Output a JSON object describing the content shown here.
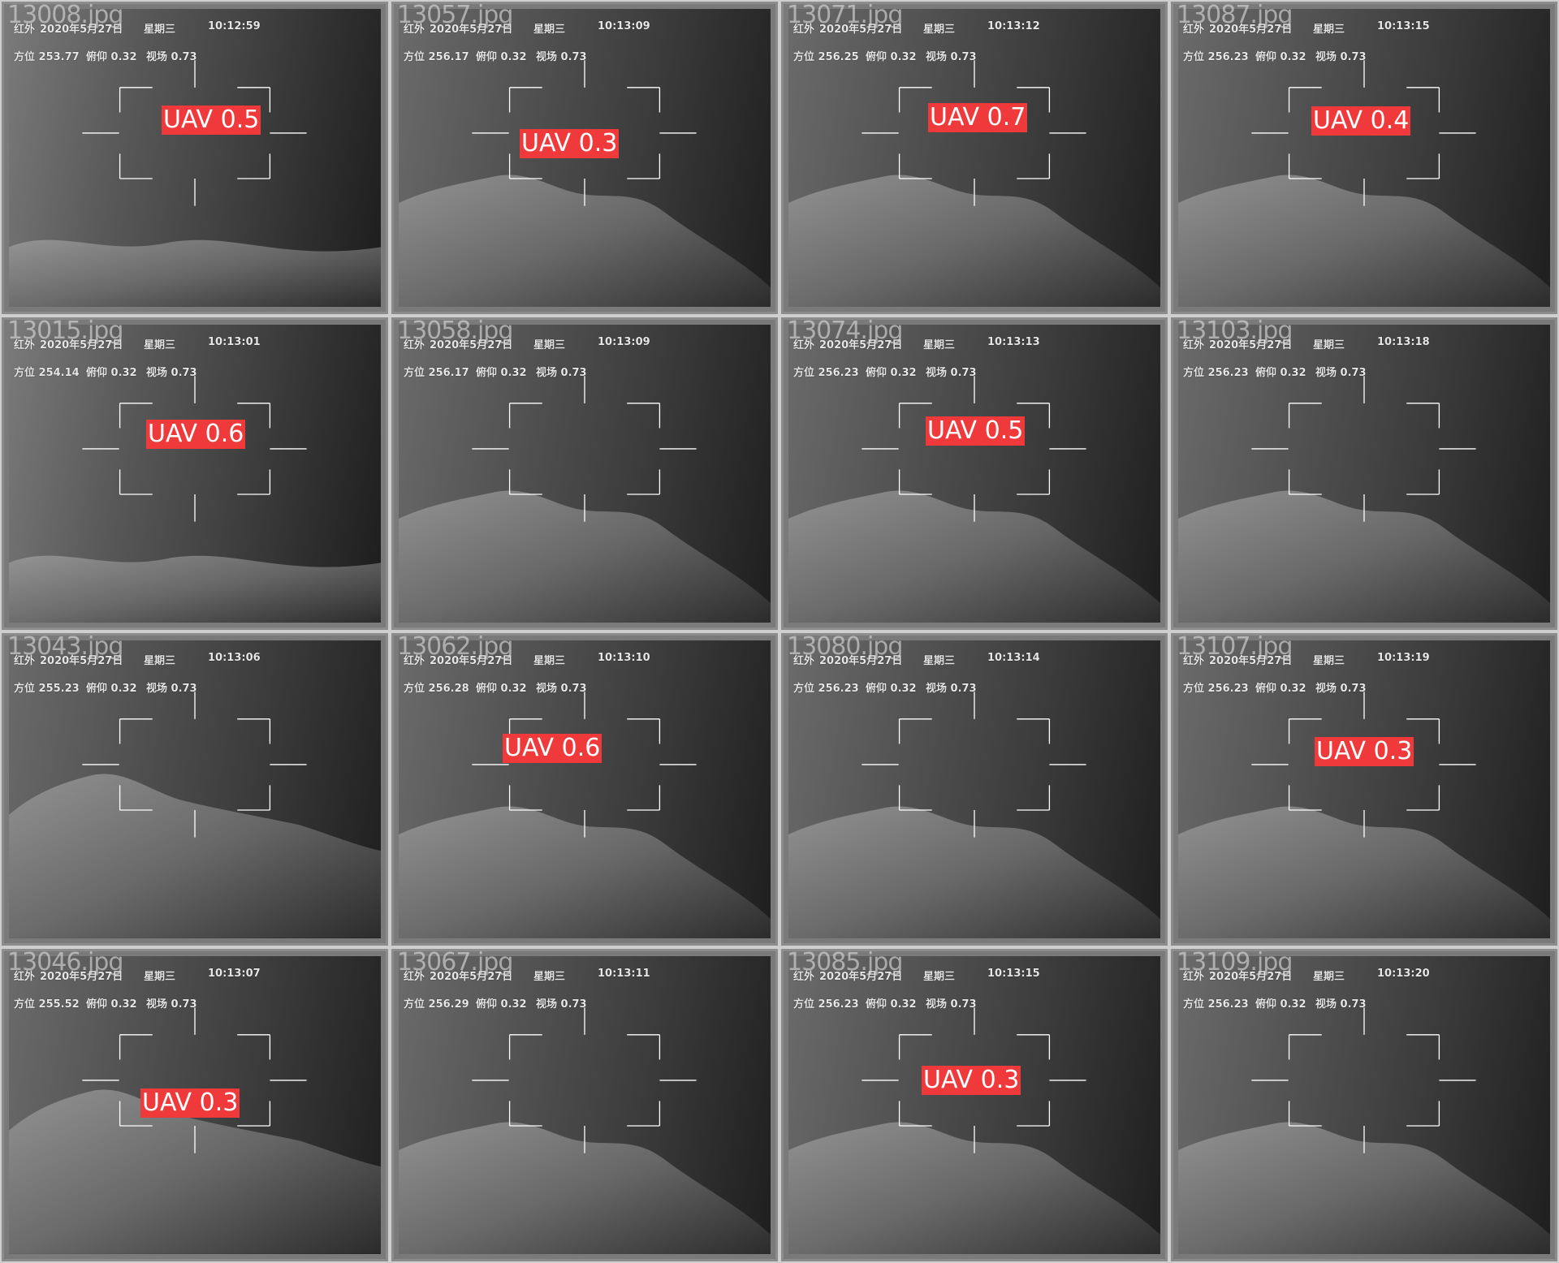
{
  "tiles": [
    {
      "filename": "13008.jpg",
      "label": "红外",
      "date": "2020年5月27日",
      "weekday": "星期三",
      "time": "10:12:59",
      "azimuth": "方位 253.77",
      "pitch": "俯仰 0.32",
      "fov": "视场 0.73",
      "detection": "UAV 0.5",
      "scene": "fog"
    },
    {
      "filename": "13057.jpg",
      "label": "红外",
      "date": "2020年5月27日",
      "weekday": "星期三",
      "time": "10:13:09",
      "azimuth": "方位 256.17",
      "pitch": "俯仰 0.32",
      "fov": "视场 0.73",
      "detection": "UAV 0.3",
      "scene": "mountain"
    },
    {
      "filename": "13071.jpg",
      "label": "红外",
      "date": "2020年5月27日",
      "weekday": "星期三",
      "time": "10:13:12",
      "azimuth": "方位 256.25",
      "pitch": "俯仰 0.32",
      "fov": "视场 0.73",
      "detection": "UAV 0.7",
      "scene": "mountain"
    },
    {
      "filename": "13087.jpg",
      "label": "红外",
      "date": "2020年5月27日",
      "weekday": "星期三",
      "time": "10:13:15",
      "azimuth": "方位 256.23",
      "pitch": "俯仰 0.32",
      "fov": "视场 0.73",
      "detection": "UAV 0.4",
      "scene": "mountain"
    },
    {
      "filename": "13015.jpg",
      "label": "红外",
      "date": "2020年5月27日",
      "weekday": "星期三",
      "time": "10:13:01",
      "azimuth": "方位 254.14",
      "pitch": "俯仰 0.32",
      "fov": "视场 0.73",
      "detection": "UAV 0.6",
      "scene": "fog"
    },
    {
      "filename": "13058.jpg",
      "label": "红外",
      "date": "2020年5月27日",
      "weekday": "星期三",
      "time": "10:13:09",
      "azimuth": "方位 256.17",
      "pitch": "俯仰 0.32",
      "fov": "视场 0.73",
      "detection": "",
      "scene": "mountain"
    },
    {
      "filename": "13074.jpg",
      "label": "红外",
      "date": "2020年5月27日",
      "weekday": "星期三",
      "time": "10:13:13",
      "azimuth": "方位 256.23",
      "pitch": "俯仰 0.32",
      "fov": "视场 0.73",
      "detection": "UAV 0.5",
      "scene": "mountain"
    },
    {
      "filename": "13103.jpg",
      "label": "红外",
      "date": "2020年5月27日",
      "weekday": "星期三",
      "time": "10:13:18",
      "azimuth": "方位 256.23",
      "pitch": "俯仰 0.32",
      "fov": "视场 0.73",
      "detection": "",
      "scene": "mountain"
    },
    {
      "filename": "13043.jpg",
      "label": "红外",
      "date": "2020年5月27日",
      "weekday": "星期三",
      "time": "10:13:06",
      "azimuth": "方位 255.23",
      "pitch": "俯仰 0.32",
      "fov": "视场 0.73",
      "detection": "",
      "scene": "peak"
    },
    {
      "filename": "13062.jpg",
      "label": "红外",
      "date": "2020年5月27日",
      "weekday": "星期三",
      "time": "10:13:10",
      "azimuth": "方位 256.28",
      "pitch": "俯仰 0.32",
      "fov": "视场 0.73",
      "detection": "UAV 0.6",
      "scene": "mountain"
    },
    {
      "filename": "13080.jpg",
      "label": "红外",
      "date": "2020年5月27日",
      "weekday": "星期三",
      "time": "10:13:14",
      "azimuth": "方位 256.23",
      "pitch": "俯仰 0.32",
      "fov": "视场 0.73",
      "detection": "",
      "scene": "mountain"
    },
    {
      "filename": "13107.jpg",
      "label": "红外",
      "date": "2020年5月27日",
      "weekday": "星期三",
      "time": "10:13:19",
      "azimuth": "方位 256.23",
      "pitch": "俯仰 0.32",
      "fov": "视场 0.73",
      "detection": "UAV 0.3",
      "scene": "mountain"
    },
    {
      "filename": "13046.jpg",
      "label": "红外",
      "date": "2020年5月27日",
      "weekday": "星期三",
      "time": "10:13:07",
      "azimuth": "方位 255.52",
      "pitch": "俯仰 0.32",
      "fov": "视场 0.73",
      "detection": "UAV 0.3",
      "scene": "peak"
    },
    {
      "filename": "13067.jpg",
      "label": "红外",
      "date": "2020年5月27日",
      "weekday": "星期三",
      "time": "10:13:11",
      "azimuth": "方位 256.29",
      "pitch": "俯仰 0.32",
      "fov": "视场 0.73",
      "detection": "",
      "scene": "mountain"
    },
    {
      "filename": "13085.jpg",
      "label": "红外",
      "date": "2020年5月27日",
      "weekday": "星期三",
      "time": "10:13:15",
      "azimuth": "方位 256.23",
      "pitch": "俯仰 0.32",
      "fov": "视场 0.73",
      "detection": "UAV 0.3",
      "scene": "mountain"
    },
    {
      "filename": "13109.jpg",
      "label": "红外",
      "date": "2020年5月27日",
      "weekday": "星期三",
      "time": "10:13:20",
      "azimuth": "方位 256.23",
      "pitch": "俯仰 0.32",
      "fov": "视场 0.73",
      "detection": "",
      "scene": "mountain"
    }
  ],
  "colors": {
    "detection_bg": "#f0393a",
    "detection_text": "#ffffff",
    "osd_text": "#e6e6e6",
    "reticle": "#ffffff"
  }
}
